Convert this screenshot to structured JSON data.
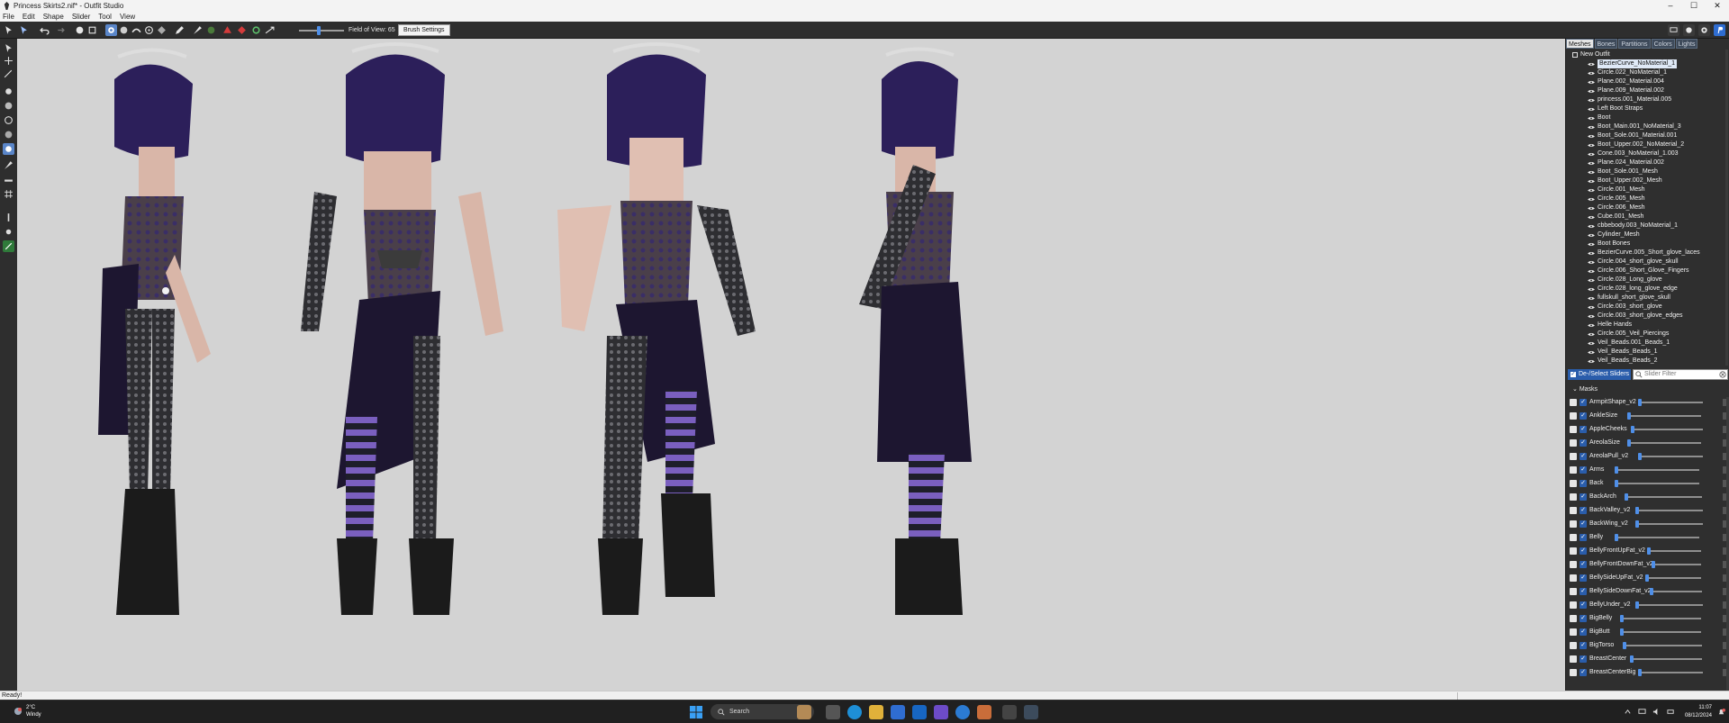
{
  "window": {
    "title": "Princess Skirts2.nif* - Outfit Studio",
    "controls": [
      "–",
      "☐",
      "✕"
    ]
  },
  "menu": [
    "File",
    "Edit",
    "Shape",
    "Slider",
    "Tool",
    "View"
  ],
  "toolbar": {
    "field_of_view_label": "Field of View: 65",
    "brush_settings_label": "Brush Settings"
  },
  "right_panel": {
    "tabs": [
      "Meshes",
      "Bones",
      "Partitions",
      "Colors",
      "Lights"
    ],
    "tree_root": "New Outfit",
    "meshes": [
      "BezierCurve_NoMaterial_1",
      "Circle.022_NoMaterial_1",
      "Plane.002_Material.004",
      "Plane.009_Material.002",
      "princess.001_Material.005",
      "Left Boot Straps",
      "Boot",
      "Boot_Main.001_NoMaterial_3",
      "Boot_Sole.001_Material.001",
      "Boot_Upper.002_NoMaterial_2",
      "Cone.003_NoMaterial_1.003",
      "Plane.024_Material.002",
      "Boot_Sole.001_Mesh",
      "Boot_Upper.002_Mesh",
      "Circle.001_Mesh",
      "Circle.005_Mesh",
      "Circle.006_Mesh",
      "Cube.001_Mesh",
      "cbbebody.003_NoMaterial_1",
      "Cylinder_Mesh",
      "Boot Bones",
      "BezierCurve.005_Short_glove_laces",
      "Circle.004_short_glove_skull",
      "Circle.006_Short_Glove_Fingers",
      "Circle.028_Long_glove",
      "Circle.028_long_glove_edge",
      "fullskull_short_glove_skull",
      "Circle.003_short_glove",
      "Circle.003_short_glove_edges",
      "Helle Hands",
      "Circle.005_Veil_Piercings",
      "Veil_Beads.001_Beads_1",
      "Veil_Beads_Beads_1",
      "Veil_Beads_Beads_2"
    ],
    "deselect_label": "De-/Select Sliders",
    "slider_filter_placeholder": "Slider Filter",
    "masks_label": "Masks",
    "sliders": [
      {
        "name": "ArmpitShape_v2",
        "value": 0.0
      },
      {
        "name": "AnkleSize",
        "value": 0.0
      },
      {
        "name": "AppleCheeks",
        "value": 0.0
      },
      {
        "name": "AreolaSize",
        "value": 0.0
      },
      {
        "name": "AreolaPull_v2",
        "value": 0.0
      },
      {
        "name": "Arms",
        "value": 0.0
      },
      {
        "name": "Back",
        "value": 0.0
      },
      {
        "name": "BackArch",
        "value": 0.0
      },
      {
        "name": "BackValley_v2",
        "value": 0.0
      },
      {
        "name": "BackWing_v2",
        "value": 0.0
      },
      {
        "name": "Belly",
        "value": 0.0
      },
      {
        "name": "BellyFrontUpFat_v2",
        "value": 0.0
      },
      {
        "name": "BellyFrontDownFat_v2",
        "value": 0.0
      },
      {
        "name": "BellySideUpFat_v2",
        "value": 0.0
      },
      {
        "name": "BellySideDownFat_v2",
        "value": 0.0
      },
      {
        "name": "BellyUnder_v2",
        "value": 0.0
      },
      {
        "name": "BigBelly",
        "value": 0.0
      },
      {
        "name": "BigButt",
        "value": 0.0
      },
      {
        "name": "BigTorso",
        "value": 0.0
      },
      {
        "name": "BreastCenter",
        "value": 0.0
      },
      {
        "name": "BreastCenterBig",
        "value": 0.0
      }
    ]
  },
  "status": {
    "text": "Ready!"
  },
  "taskbar": {
    "weather_temp": "2°C",
    "weather_desc": "Windy",
    "search_label": "Search",
    "time": "11:07",
    "date": "08/12/2024"
  },
  "colors": {
    "dark_ui": "#2e2e2e",
    "accent": "#4f8fe8",
    "viewport_bg": "#d3d3d3",
    "veil_purple": "#2c1f5a",
    "stocking_stripe": "#7a5fbf"
  }
}
